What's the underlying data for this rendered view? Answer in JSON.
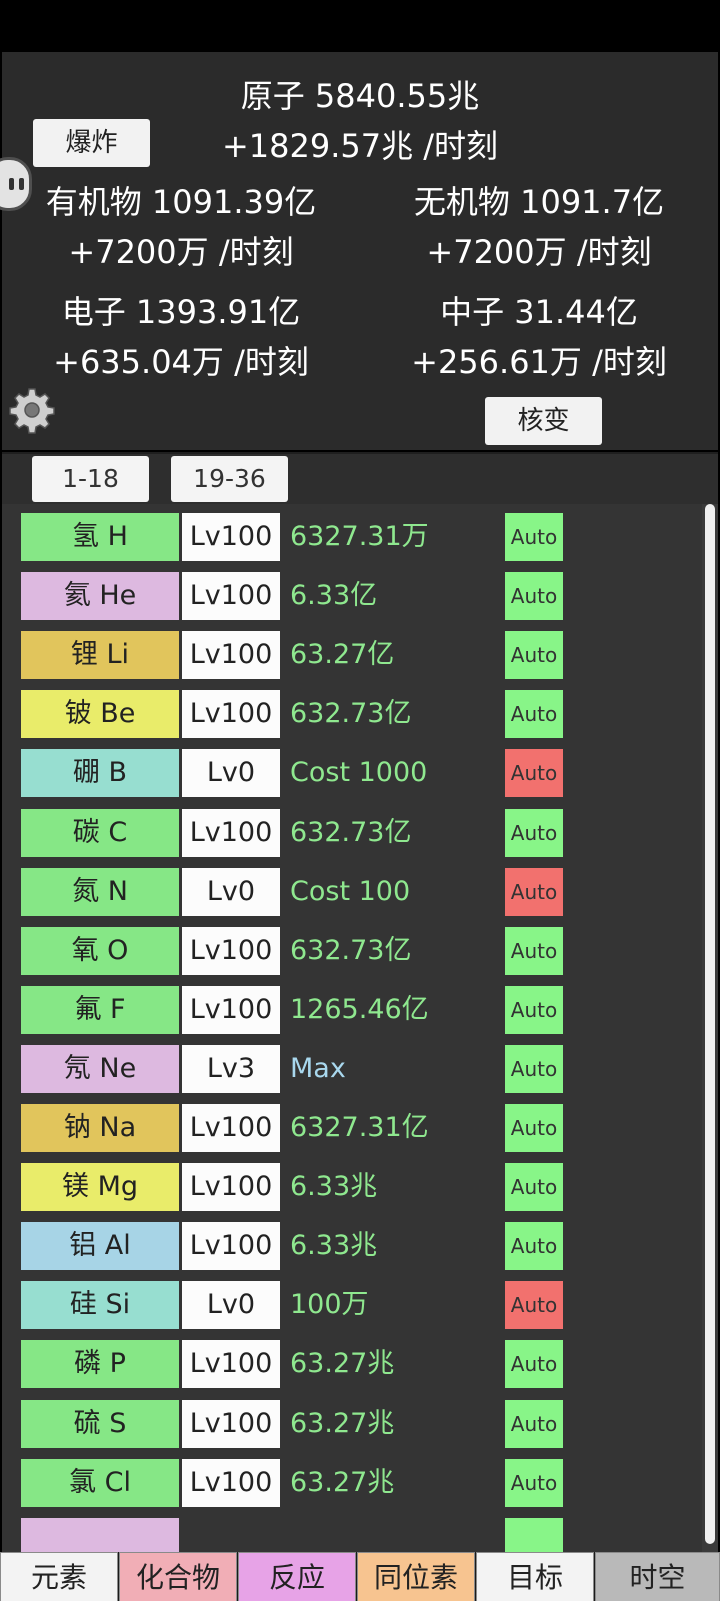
{
  "stats": {
    "atom": {
      "text": "原子 5840.55兆",
      "rate": "+1829.57兆 /时刻"
    },
    "organic": {
      "text": "有机物 1091.39亿",
      "rate": "+7200万 /时刻"
    },
    "inorganic": {
      "text": "无机物 1091.7亿",
      "rate": "+7200万 /时刻"
    },
    "electron": {
      "text": "电子 1393.91亿",
      "rate": "+635.04万 /时刻"
    },
    "neutron": {
      "text": "中子 31.44亿",
      "rate": "+256.61万 /时刻"
    },
    "explode_label": "爆炸",
    "fission_label": "核变"
  },
  "group_tabs": {
    "tab1": "1-18",
    "tab2": "19-36"
  },
  "colors": {
    "green": "#86e786",
    "purple": "#ddb9e0",
    "gold": "#e1c55c",
    "yellow": "#e9ec6a",
    "teal": "#97ded0",
    "blue": "#a7d4e6",
    "pink": "#e7a3e7",
    "auto_on": "#88f588",
    "auto_off": "#f2716e",
    "value_green": "#8fe88f",
    "value_blue": "#a9d8ee"
  },
  "elements": [
    {
      "name": "氢 H",
      "level": "Lv100",
      "value": "6327.31万",
      "color": "#86e786",
      "value_color": "#8fe88f",
      "auto": "Auto",
      "auto_color": "#88f588"
    },
    {
      "name": "氦 He",
      "level": "Lv100",
      "value": "6.33亿",
      "color": "#ddb9e0",
      "value_color": "#8fe88f",
      "auto": "Auto",
      "auto_color": "#88f588"
    },
    {
      "name": "锂 Li",
      "level": "Lv100",
      "value": "63.27亿",
      "color": "#e1c55c",
      "value_color": "#8fe88f",
      "auto": "Auto",
      "auto_color": "#88f588"
    },
    {
      "name": "铍 Be",
      "level": "Lv100",
      "value": "632.73亿",
      "color": "#e9ec6a",
      "value_color": "#8fe88f",
      "auto": "Auto",
      "auto_color": "#88f588"
    },
    {
      "name": "硼 B",
      "level": "Lv0",
      "value": "Cost 1000",
      "color": "#97ded0",
      "value_color": "#8fe88f",
      "auto": "Auto",
      "auto_color": "#f2716e"
    },
    {
      "name": "碳 C",
      "level": "Lv100",
      "value": "632.73亿",
      "color": "#86e786",
      "value_color": "#8fe88f",
      "auto": "Auto",
      "auto_color": "#88f588"
    },
    {
      "name": "氮 N",
      "level": "Lv0",
      "value": "Cost 100",
      "color": "#86e786",
      "value_color": "#8fe88f",
      "auto": "Auto",
      "auto_color": "#f2716e"
    },
    {
      "name": "氧 O",
      "level": "Lv100",
      "value": "632.73亿",
      "color": "#86e786",
      "value_color": "#8fe88f",
      "auto": "Auto",
      "auto_color": "#88f588"
    },
    {
      "name": "氟 F",
      "level": "Lv100",
      "value": "1265.46亿",
      "color": "#86e786",
      "value_color": "#8fe88f",
      "auto": "Auto",
      "auto_color": "#88f588"
    },
    {
      "name": "氖 Ne",
      "level": "Lv3",
      "value": "Max",
      "color": "#ddb9e0",
      "value_color": "#a9d8ee",
      "auto": "Auto",
      "auto_color": "#88f588"
    },
    {
      "name": "钠 Na",
      "level": "Lv100",
      "value": "6327.31亿",
      "color": "#e1c55c",
      "value_color": "#8fe88f",
      "auto": "Auto",
      "auto_color": "#88f588"
    },
    {
      "name": "镁 Mg",
      "level": "Lv100",
      "value": "6.33兆",
      "color": "#e9ec6a",
      "value_color": "#8fe88f",
      "auto": "Auto",
      "auto_color": "#88f588"
    },
    {
      "name": "铝 Al",
      "level": "Lv100",
      "value": "6.33兆",
      "color": "#a7d4e6",
      "value_color": "#8fe88f",
      "auto": "Auto",
      "auto_color": "#88f588"
    },
    {
      "name": "硅 Si",
      "level": "Lv0",
      "value": "100万",
      "color": "#97ded0",
      "value_color": "#8fe88f",
      "auto": "Auto",
      "auto_color": "#f2716e"
    },
    {
      "name": "磷 P",
      "level": "Lv100",
      "value": "63.27兆",
      "color": "#86e786",
      "value_color": "#8fe88f",
      "auto": "Auto",
      "auto_color": "#88f588"
    },
    {
      "name": "硫 S",
      "level": "Lv100",
      "value": "63.27兆",
      "color": "#86e786",
      "value_color": "#8fe88f",
      "auto": "Auto",
      "auto_color": "#88f588"
    },
    {
      "name": "氯 Cl",
      "level": "Lv100",
      "value": "63.27兆",
      "color": "#86e786",
      "value_color": "#8fe88f",
      "auto": "Auto",
      "auto_color": "#88f588"
    },
    {
      "name": "",
      "level": "",
      "value": "",
      "color": "#ddb9e0",
      "value_color": "#8fe88f",
      "auto": "",
      "auto_color": "#88f588"
    }
  ],
  "nav": [
    {
      "label": "元素",
      "color": "#f3f3f3"
    },
    {
      "label": "化合物",
      "color": "#f1aeb6"
    },
    {
      "label": "反应",
      "color": "#e7a3e7"
    },
    {
      "label": "同位素",
      "color": "#f7c490"
    },
    {
      "label": "目标",
      "color": "#f3f3f3"
    },
    {
      "label": "时空",
      "color": "#b9b9b9"
    }
  ]
}
